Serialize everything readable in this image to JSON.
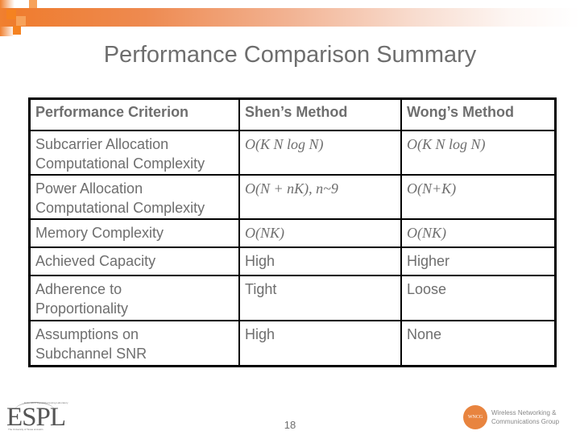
{
  "slide": {
    "title": "Performance Comparison Summary",
    "page_number": "18",
    "accent_color": "#f58220"
  },
  "table": {
    "headers": [
      "Performance Criterion",
      "Shen’s Method",
      "Wong’s Method"
    ],
    "rows": [
      {
        "criterion": [
          "Subcarrier Allocation",
          "Computational Complexity"
        ],
        "shen": "O(K N log N)",
        "wong": "O(K N log N)"
      },
      {
        "criterion": [
          "Power Allocation",
          "Computational Complexity"
        ],
        "shen": "O(N + nK), n~9",
        "wong": "O(N+K)"
      },
      {
        "criterion": [
          "Memory Complexity"
        ],
        "shen": "O(NK)",
        "wong": "O(NK)"
      },
      {
        "criterion": [
          "Achieved Capacity"
        ],
        "shen": "High",
        "wong": "Higher"
      },
      {
        "criterion": [
          "Adherence to",
          "Proportionality"
        ],
        "shen": "Tight",
        "wong": "Loose"
      },
      {
        "criterion": [
          "Assumptions on",
          "Subchannel SNR"
        ],
        "shen": "High",
        "wong": "None"
      }
    ]
  },
  "logos": {
    "left": {
      "name": "ESPL",
      "top_caption": "Embedded Signal Processing Laboratory",
      "bottom_caption": "The University of Texas at Austin"
    },
    "right": {
      "badge": "WNCG",
      "line1": "Wireless Networking &",
      "line2": "Communications Group"
    }
  }
}
